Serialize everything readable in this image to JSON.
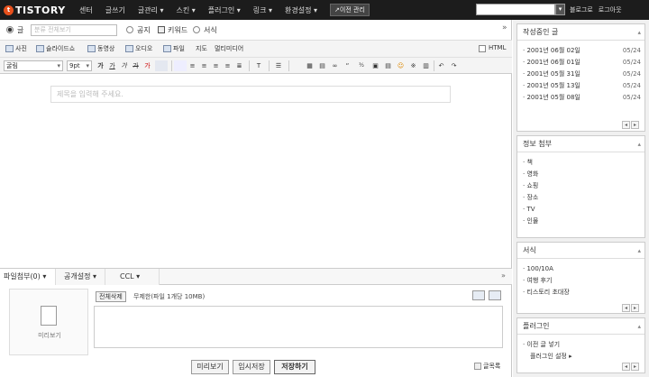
{
  "topbar": {
    "logo_icon": "t",
    "logo_text": "TISTORY",
    "nav": [
      "센터",
      "글쓰기",
      "글관리 ▾",
      "스킨 ▾",
      "플러그인 ▾",
      "링크 ▾",
      "환경설정 ▾"
    ],
    "old_admin": "↗이전 관리",
    "search_button": "▾",
    "links": [
      "블로그로",
      "로그아웃"
    ]
  },
  "category": {
    "radio_post": "글",
    "placeholder": "분류 전체보기",
    "radio_notice": "공지",
    "radio_keyword": "키워드",
    "radio_form": "서식",
    "collapse": "»"
  },
  "media": {
    "items": [
      "사진",
      "슬라이드쇼",
      "동영상",
      "오디오",
      "파일",
      "지도",
      "멀티미디어"
    ],
    "html_label": "HTML"
  },
  "format": {
    "font": "굴림",
    "size": "9pt",
    "buttons": [
      "가",
      "가",
      "가",
      "가",
      "가",
      "≡",
      "≡",
      "≡",
      "≡",
      "≣",
      "T",
      "☰",
      "▦",
      "▤",
      "∞",
      "“",
      "³⁄₂",
      "▣",
      "▤",
      "☺",
      "※",
      "▥",
      "↶",
      "↷"
    ]
  },
  "editor": {
    "title_placeholder": "제목을 입력해 주세요."
  },
  "bottom_tabs": {
    "attach": "파일첨부(0)",
    "attach_count": "0",
    "privacy": "공개설정",
    "ccl": "CCL",
    "expand": "»"
  },
  "attach": {
    "preview_label": "미리보기",
    "delete_all": "전체삭제",
    "limit": "무제한(파일 1개당 10MB)"
  },
  "actions": {
    "preview": "미리보기",
    "temp_save": "임시저장",
    "save": "저장하기",
    "list": "글목록"
  },
  "right": {
    "drafts": {
      "title": "작성중인 글",
      "items": [
        {
          "label": "2001년 06월 02일",
          "date": "05/24"
        },
        {
          "label": "2001년 06월 01일",
          "date": "05/24"
        },
        {
          "label": "2001년 05월 31일",
          "date": "05/24"
        },
        {
          "label": "2001년 05월 13일",
          "date": "05/24"
        },
        {
          "label": "2001년 05월 08일",
          "date": "05/24"
        }
      ]
    },
    "info": {
      "title": "정보 첨부",
      "items": [
        "책",
        "영화",
        "쇼핑",
        "장소",
        "TV",
        "인물"
      ]
    },
    "form": {
      "title": "서식",
      "items": [
        "100/10A",
        "여행 후기",
        "티스토리 초대장"
      ]
    },
    "plugin": {
      "title": "플러그인",
      "items": [
        "이전 글 넣기",
        "플러그인 설정 ▸"
      ]
    },
    "pager": [
      "◂",
      "▸"
    ]
  }
}
